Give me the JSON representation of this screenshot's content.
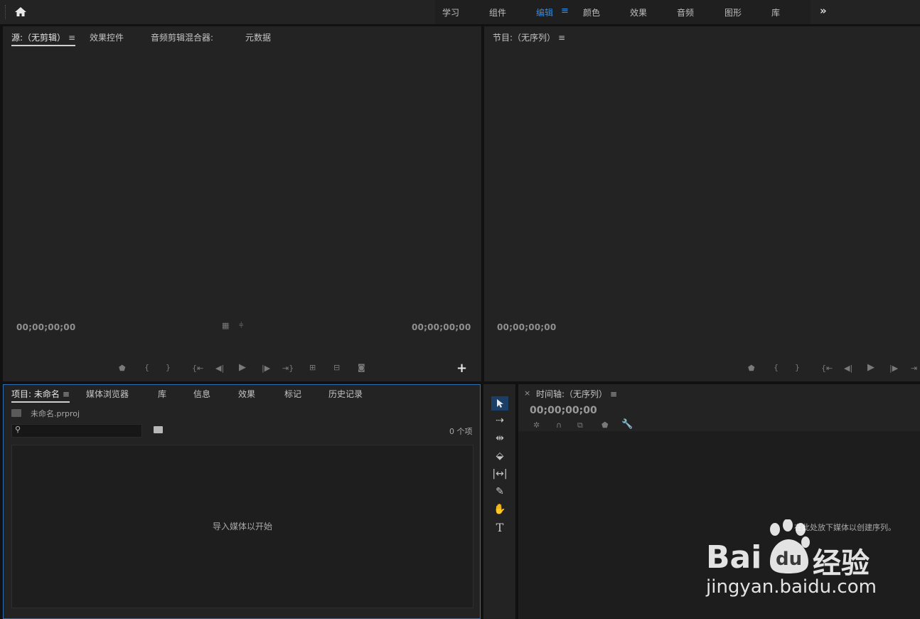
{
  "workspaces": {
    "items": [
      "学习",
      "组件",
      "编辑",
      "颜色",
      "效果",
      "音频",
      "图形",
      "库"
    ],
    "menu_icon": "≡",
    "more_icon": "»"
  },
  "source": {
    "tabs": [
      "源:（无剪辑）",
      "效果控件",
      "音频剪辑混合器:",
      "元数据"
    ],
    "tab_menu": "≡",
    "tc_left": "00;00;00;00",
    "tc_right": "00;00;00;00",
    "add": "+"
  },
  "program": {
    "title": "节目:（无序列）",
    "tab_menu": "≡",
    "tc_left": "00;00;00;00"
  },
  "project": {
    "tabs": [
      "项目: 未命名",
      "媒体浏览器",
      "库",
      "信息",
      "效果",
      "标记",
      "历史记录"
    ],
    "tab_menu": "≡",
    "file": "未命名.prproj",
    "count": "0 个项",
    "import_hint": "导入媒体以开始"
  },
  "timeline": {
    "close": "×",
    "title": "时间轴:（无序列）",
    "tab_menu": "≡",
    "tc": "00;00;00;00",
    "drop_hint": "在此处放下媒体以创建序列。"
  },
  "watermark": {
    "brand": "Bai",
    "du": "du",
    "cn": "经验",
    "url": "jingyan.baidu.com"
  },
  "colors": {
    "accent": "#2d8ceb",
    "panel": "#232323",
    "background": "#111111"
  }
}
